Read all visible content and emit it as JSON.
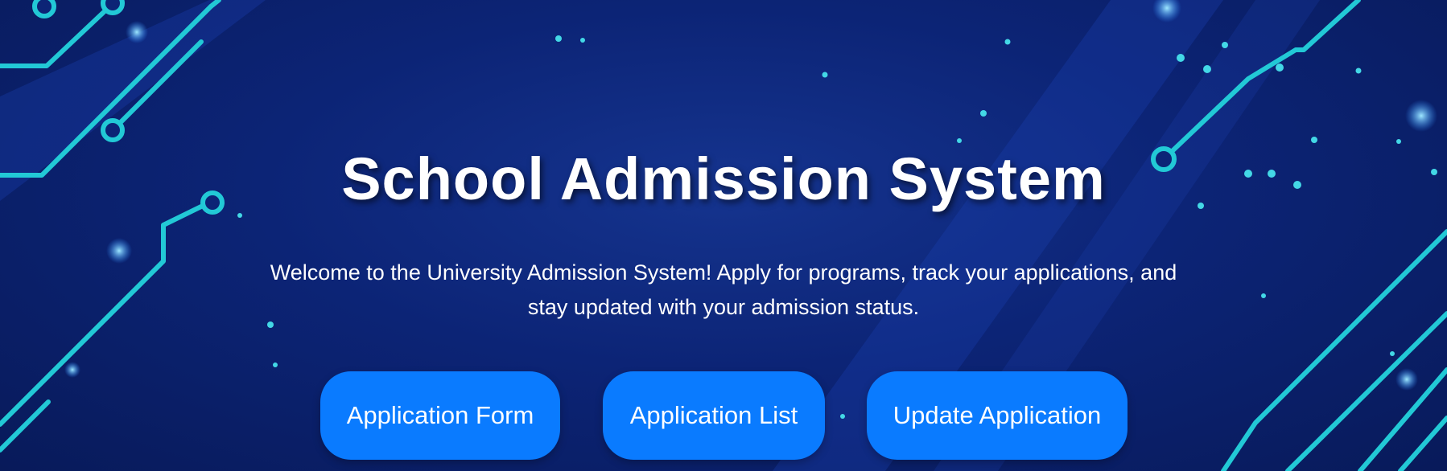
{
  "hero": {
    "title": "School Admission System",
    "subtitle": "Welcome to the University Admission System! Apply for programs, track your applications, and stay updated with your admission status.",
    "background_icon": "circuit-board-background",
    "accent_color": "#1fd4d4",
    "background_color": "#0c2476"
  },
  "actions": [
    {
      "label": "Application Form",
      "color": "#0a7bff"
    },
    {
      "label": "Application List",
      "color": "#0a7bff"
    },
    {
      "label": "Update Application",
      "color": "#0a7bff"
    }
  ]
}
